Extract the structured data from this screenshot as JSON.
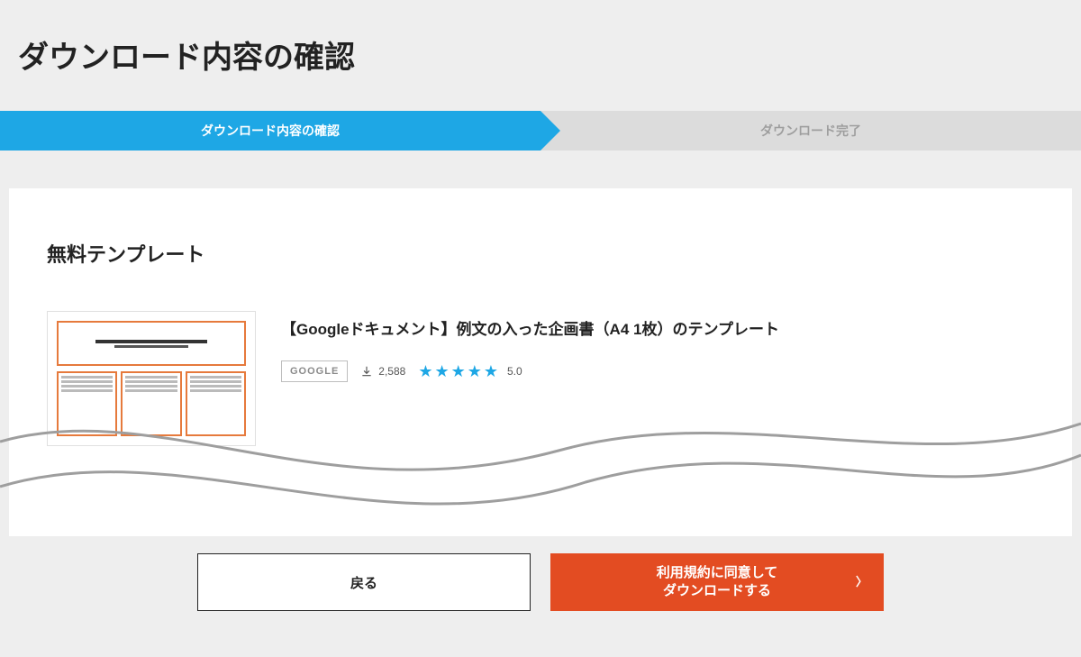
{
  "page": {
    "title": "ダウンロード内容の確認"
  },
  "steps": {
    "active": "ダウンロード内容の確認",
    "inactive": "ダウンロード完了"
  },
  "section": {
    "heading": "無料テンプレート"
  },
  "item": {
    "title": "【Googleドキュメント】例文の入った企画書（A4 1枚）のテンプレート",
    "badge": "GOOGLE",
    "downloads": "2,588",
    "stars": "★★★★★",
    "rating": "5.0"
  },
  "actions": {
    "back": "戻る",
    "primary_line1": "利用規約に同意して",
    "primary_line2": "ダウンロードする"
  }
}
